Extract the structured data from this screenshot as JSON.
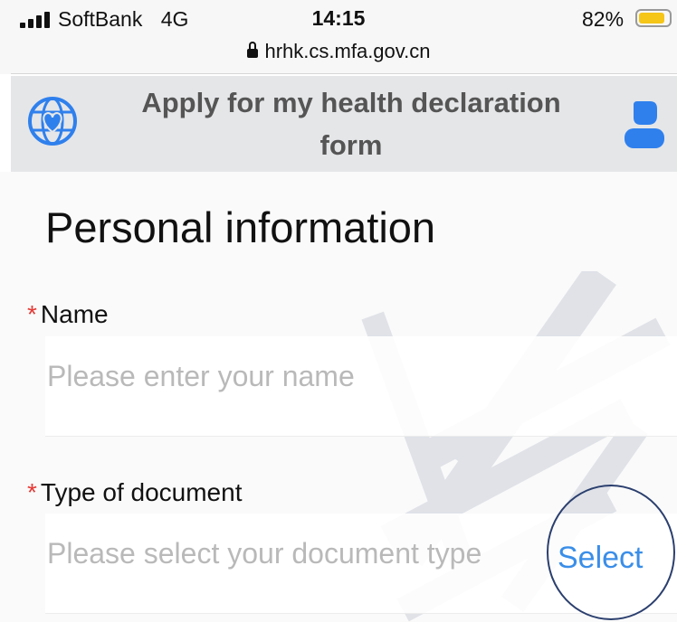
{
  "status_bar": {
    "carrier": "SoftBank",
    "network": "4G",
    "time": "14:15",
    "battery": "82%",
    "battery_level": 0.82,
    "url": "hrhk.cs.mfa.gov.cn"
  },
  "header": {
    "title_line1": "Apply for my health declaration",
    "title_line2": "form",
    "logo_icon": "globe-heart-icon",
    "profile_icon": "user-icon"
  },
  "form": {
    "section_title": "Personal information",
    "required_mark": "*",
    "name": {
      "label": "Name",
      "placeholder": "Please enter your name",
      "value": ""
    },
    "doc_type": {
      "label": "Type of document",
      "placeholder": "Please select your document type",
      "action": "Select"
    }
  },
  "colors": {
    "accent": "#3a8ee8",
    "required": "#e53935",
    "header_bg": "#e5e6e8",
    "placeholder": "#b9b9b9"
  }
}
